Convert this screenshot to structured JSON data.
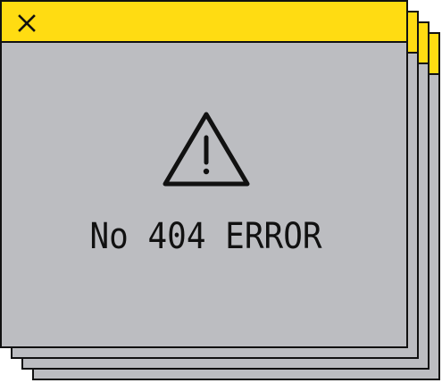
{
  "dialog": {
    "message": "No 404 ERROR"
  },
  "colors": {
    "titlebar": "#ffdc12",
    "window_body": "#bcbdc1",
    "border": "#111111"
  },
  "icons": {
    "close": "close-icon",
    "warning": "warning-icon"
  }
}
